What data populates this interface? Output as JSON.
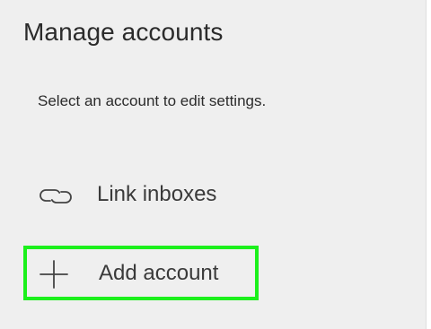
{
  "header": {
    "title": "Manage accounts"
  },
  "content": {
    "instruction": "Select an account to edit settings."
  },
  "actions": [
    {
      "label": "Link inboxes",
      "icon": "link-inboxes-icon"
    },
    {
      "label": "Add account",
      "icon": "plus-icon"
    }
  ],
  "colors": {
    "panel_background": "#efefef",
    "highlight_border": "#1cf01c",
    "text": "#2b2b2b"
  }
}
